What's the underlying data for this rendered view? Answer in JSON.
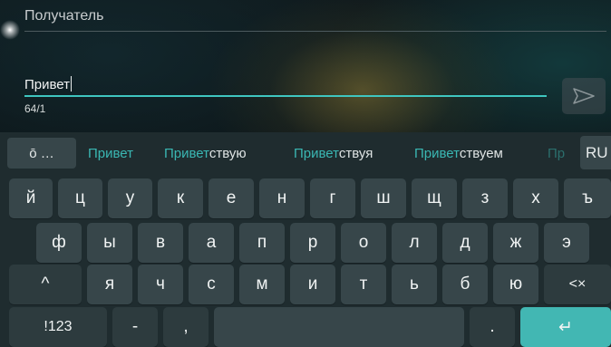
{
  "compose": {
    "recipient_label": "Получатель",
    "message_text": "Привет",
    "counter": "64/1",
    "send_icon": "send-icon"
  },
  "keyboard": {
    "tools_label": "ō …",
    "lang_label": "RU",
    "suggestions": [
      {
        "match": "Привет",
        "rest": ""
      },
      {
        "match": "Привет",
        "rest": "ствую"
      },
      {
        "match": "Привет",
        "rest": "ствуя"
      },
      {
        "match": "Привет",
        "rest": "ствуем"
      },
      {
        "match": "Пр",
        "rest": ""
      }
    ],
    "rows": [
      [
        "й",
        "ц",
        "у",
        "к",
        "е",
        "н",
        "г",
        "ш",
        "щ",
        "з",
        "х",
        "ъ"
      ],
      [
        "ф",
        "ы",
        "в",
        "а",
        "п",
        "р",
        "о",
        "л",
        "д",
        "ж",
        "э"
      ],
      [
        "^",
        "я",
        "ч",
        "с",
        "м",
        "и",
        "т",
        "ь",
        "б",
        "ю",
        "<×"
      ],
      [
        "!123",
        "-",
        ",",
        "",
        ".",
        "↵"
      ]
    ],
    "accent_color": "#42b7b3"
  }
}
